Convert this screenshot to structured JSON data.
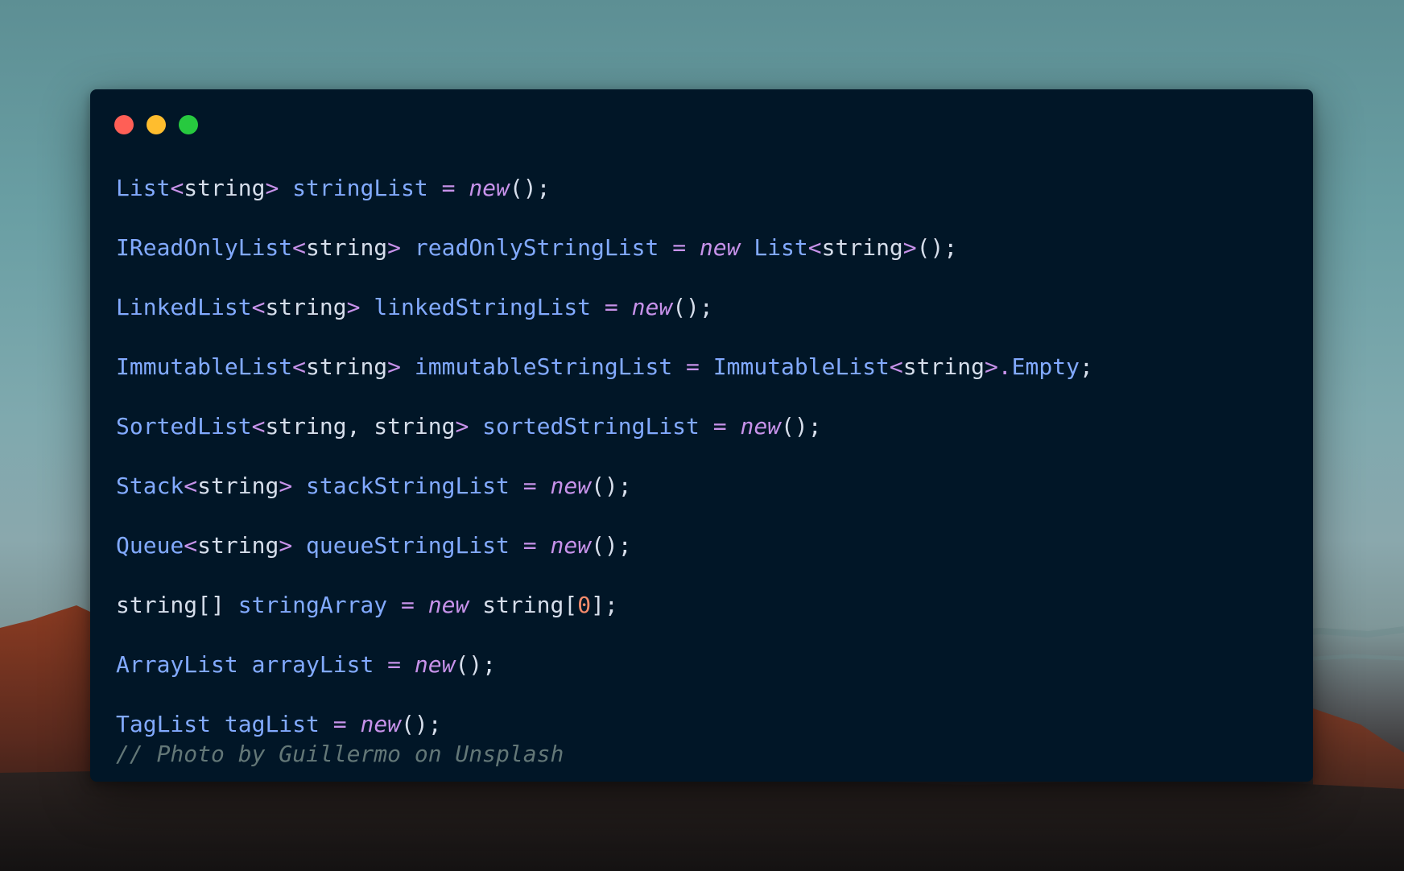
{
  "theme": {
    "window_bg": "#011627",
    "type_color": "#82aaff",
    "punct_color": "#c792ea",
    "text_color": "#d6deeb",
    "keyword_color": "#c792ea",
    "number_color": "#f78c6c",
    "comment_color": "#637777"
  },
  "window_controls": [
    {
      "name": "close",
      "color": "#ff5f56"
    },
    {
      "name": "minimize",
      "color": "#ffbd2e"
    },
    {
      "name": "maximize",
      "color": "#27c93f"
    }
  ],
  "code_lines": [
    {
      "tokens": [
        {
          "text": "List",
          "type": "type"
        },
        {
          "text": "<",
          "type": "punct"
        },
        {
          "text": "string",
          "type": "text"
        },
        {
          "text": ">",
          "type": "punct"
        },
        {
          "text": " ",
          "type": "text"
        },
        {
          "text": "stringList",
          "type": "ident"
        },
        {
          "text": " ",
          "type": "text"
        },
        {
          "text": "=",
          "type": "punct"
        },
        {
          "text": " ",
          "type": "text"
        },
        {
          "text": "new",
          "type": "kw"
        },
        {
          "text": "();",
          "type": "text"
        }
      ]
    },
    {
      "tokens": [
        {
          "text": "IReadOnlyList",
          "type": "type"
        },
        {
          "text": "<",
          "type": "punct"
        },
        {
          "text": "string",
          "type": "text"
        },
        {
          "text": ">",
          "type": "punct"
        },
        {
          "text": " ",
          "type": "text"
        },
        {
          "text": "readOnlyStringList",
          "type": "ident"
        },
        {
          "text": " ",
          "type": "text"
        },
        {
          "text": "=",
          "type": "punct"
        },
        {
          "text": " ",
          "type": "text"
        },
        {
          "text": "new",
          "type": "kw"
        },
        {
          "text": " ",
          "type": "text"
        },
        {
          "text": "List",
          "type": "type"
        },
        {
          "text": "<",
          "type": "punct"
        },
        {
          "text": "string",
          "type": "text"
        },
        {
          "text": ">",
          "type": "punct"
        },
        {
          "text": "();",
          "type": "text"
        }
      ]
    },
    {
      "tokens": [
        {
          "text": "LinkedList",
          "type": "type"
        },
        {
          "text": "<",
          "type": "punct"
        },
        {
          "text": "string",
          "type": "text"
        },
        {
          "text": ">",
          "type": "punct"
        },
        {
          "text": " ",
          "type": "text"
        },
        {
          "text": "linkedStringList",
          "type": "ident"
        },
        {
          "text": " ",
          "type": "text"
        },
        {
          "text": "=",
          "type": "punct"
        },
        {
          "text": " ",
          "type": "text"
        },
        {
          "text": "new",
          "type": "kw"
        },
        {
          "text": "();",
          "type": "text"
        }
      ]
    },
    {
      "tokens": [
        {
          "text": "ImmutableList",
          "type": "type"
        },
        {
          "text": "<",
          "type": "punct"
        },
        {
          "text": "string",
          "type": "text"
        },
        {
          "text": ">",
          "type": "punct"
        },
        {
          "text": " ",
          "type": "text"
        },
        {
          "text": "immutableStringList",
          "type": "ident"
        },
        {
          "text": " ",
          "type": "text"
        },
        {
          "text": "=",
          "type": "punct"
        },
        {
          "text": " ",
          "type": "text"
        },
        {
          "text": "ImmutableList",
          "type": "type"
        },
        {
          "text": "<",
          "type": "punct"
        },
        {
          "text": "string",
          "type": "text"
        },
        {
          "text": ">",
          "type": "punct"
        },
        {
          "text": ".",
          "type": "punct"
        },
        {
          "text": "Empty",
          "type": "type"
        },
        {
          "text": ";",
          "type": "text"
        }
      ]
    },
    {
      "tokens": [
        {
          "text": "SortedList",
          "type": "type"
        },
        {
          "text": "<",
          "type": "punct"
        },
        {
          "text": "string, string",
          "type": "text"
        },
        {
          "text": ">",
          "type": "punct"
        },
        {
          "text": " ",
          "type": "text"
        },
        {
          "text": "sortedStringList",
          "type": "ident"
        },
        {
          "text": " ",
          "type": "text"
        },
        {
          "text": "=",
          "type": "punct"
        },
        {
          "text": " ",
          "type": "text"
        },
        {
          "text": "new",
          "type": "kw"
        },
        {
          "text": "();",
          "type": "text"
        }
      ]
    },
    {
      "tokens": [
        {
          "text": "Stack",
          "type": "type"
        },
        {
          "text": "<",
          "type": "punct"
        },
        {
          "text": "string",
          "type": "text"
        },
        {
          "text": ">",
          "type": "punct"
        },
        {
          "text": " ",
          "type": "text"
        },
        {
          "text": "stackStringList",
          "type": "ident"
        },
        {
          "text": " ",
          "type": "text"
        },
        {
          "text": "=",
          "type": "punct"
        },
        {
          "text": " ",
          "type": "text"
        },
        {
          "text": "new",
          "type": "kw"
        },
        {
          "text": "();",
          "type": "text"
        }
      ]
    },
    {
      "tokens": [
        {
          "text": "Queue",
          "type": "type"
        },
        {
          "text": "<",
          "type": "punct"
        },
        {
          "text": "string",
          "type": "text"
        },
        {
          "text": ">",
          "type": "punct"
        },
        {
          "text": " ",
          "type": "text"
        },
        {
          "text": "queueStringList",
          "type": "ident"
        },
        {
          "text": " ",
          "type": "text"
        },
        {
          "text": "=",
          "type": "punct"
        },
        {
          "text": " ",
          "type": "text"
        },
        {
          "text": "new",
          "type": "kw"
        },
        {
          "text": "();",
          "type": "text"
        }
      ]
    },
    {
      "tokens": [
        {
          "text": "string[]",
          "type": "text"
        },
        {
          "text": " ",
          "type": "text"
        },
        {
          "text": "stringArray",
          "type": "ident"
        },
        {
          "text": " ",
          "type": "text"
        },
        {
          "text": "=",
          "type": "punct"
        },
        {
          "text": " ",
          "type": "text"
        },
        {
          "text": "new",
          "type": "kw"
        },
        {
          "text": " ",
          "type": "text"
        },
        {
          "text": "string[",
          "type": "text"
        },
        {
          "text": "0",
          "type": "num"
        },
        {
          "text": "];",
          "type": "text"
        }
      ]
    },
    {
      "tokens": [
        {
          "text": "ArrayList",
          "type": "type"
        },
        {
          "text": " ",
          "type": "text"
        },
        {
          "text": "arrayList",
          "type": "ident"
        },
        {
          "text": " ",
          "type": "text"
        },
        {
          "text": "=",
          "type": "punct"
        },
        {
          "text": " ",
          "type": "text"
        },
        {
          "text": "new",
          "type": "kw"
        },
        {
          "text": "();",
          "type": "text"
        }
      ]
    },
    {
      "tokens": [
        {
          "text": "TagList",
          "type": "type"
        },
        {
          "text": " ",
          "type": "text"
        },
        {
          "text": "tagList",
          "type": "ident"
        },
        {
          "text": " ",
          "type": "text"
        },
        {
          "text": "=",
          "type": "punct"
        },
        {
          "text": " ",
          "type": "text"
        },
        {
          "text": "new",
          "type": "kw"
        },
        {
          "text": "();",
          "type": "text"
        }
      ]
    }
  ],
  "comment_line": "// Photo by Guillermo on Unsplash"
}
